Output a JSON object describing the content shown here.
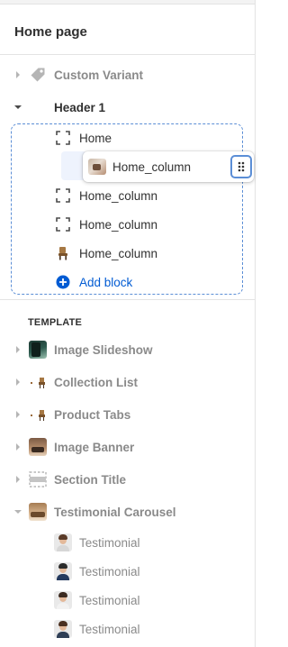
{
  "page": {
    "title": "Home page"
  },
  "tree": {
    "custom_variant": {
      "label": "Custom Variant",
      "icon": "tag-icon"
    },
    "header": {
      "label": "Header 1",
      "blocks": [
        {
          "label": "Home",
          "icon": "dashed-frame-icon"
        },
        {
          "label": "Home_column",
          "icon": "dashed-frame-icon"
        },
        {
          "label": "Home_column",
          "icon": "dashed-frame-icon"
        },
        {
          "label": "Home_column",
          "icon": "chair-icon"
        }
      ],
      "dragging": {
        "label": "Home_column",
        "icon": "product-image-thumbnail",
        "handle_icon": "drag-handle-icon"
      },
      "add_block": {
        "label": "Add block",
        "icon": "plus-circle-icon"
      }
    },
    "template": {
      "heading": "TEMPLATE",
      "sections": [
        {
          "label": "Image Slideshow",
          "icon": "slideshow-thumbnail"
        },
        {
          "label": "Collection List",
          "icon": "collection-thumbnail"
        },
        {
          "label": "Product Tabs",
          "icon": "product-thumbnail"
        },
        {
          "label": "Image Banner",
          "icon": "banner-thumbnail"
        },
        {
          "label": "Section Title",
          "icon": "section-title-icon"
        },
        {
          "label": "Testimonial Carousel",
          "icon": "carousel-thumbnail"
        }
      ],
      "testimonials": [
        {
          "label": "Testimonial"
        },
        {
          "label": "Testimonial"
        },
        {
          "label": "Testimonial"
        },
        {
          "label": "Testimonial"
        }
      ]
    }
  },
  "colors": {
    "accent_blue": "#005bd3",
    "drop_outline": "#5b8ed6",
    "muted_text": "#8a8a8a",
    "text": "#303030"
  }
}
